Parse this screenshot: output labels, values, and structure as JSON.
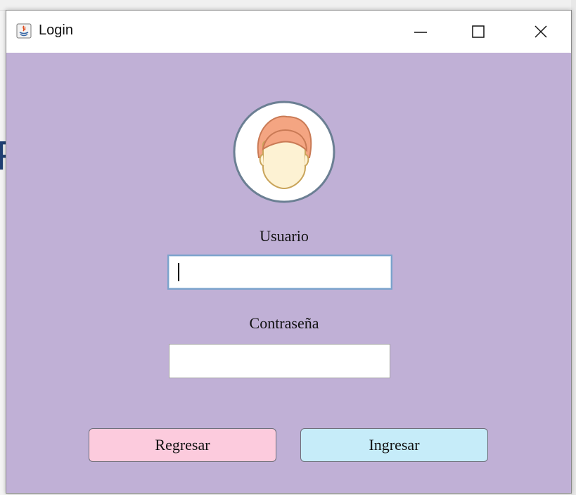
{
  "window": {
    "title": "Login"
  },
  "colors": {
    "panel_background": "#c0b0d6",
    "back_button": "#fccbdd",
    "login_button": "#c6ecf9",
    "avatar_hair": "#f4a582",
    "avatar_skin": "#fdf2d3"
  },
  "icons": {
    "app": "java-icon",
    "avatar": "user-face-icon",
    "minimize": "minimize-icon",
    "maximize": "maximize-icon",
    "close": "close-icon"
  },
  "form": {
    "username_label": "Usuario",
    "username_value": "",
    "password_label": "Contraseña",
    "password_value": ""
  },
  "buttons": {
    "back_label": "Regresar",
    "login_label": "Ingresar"
  }
}
